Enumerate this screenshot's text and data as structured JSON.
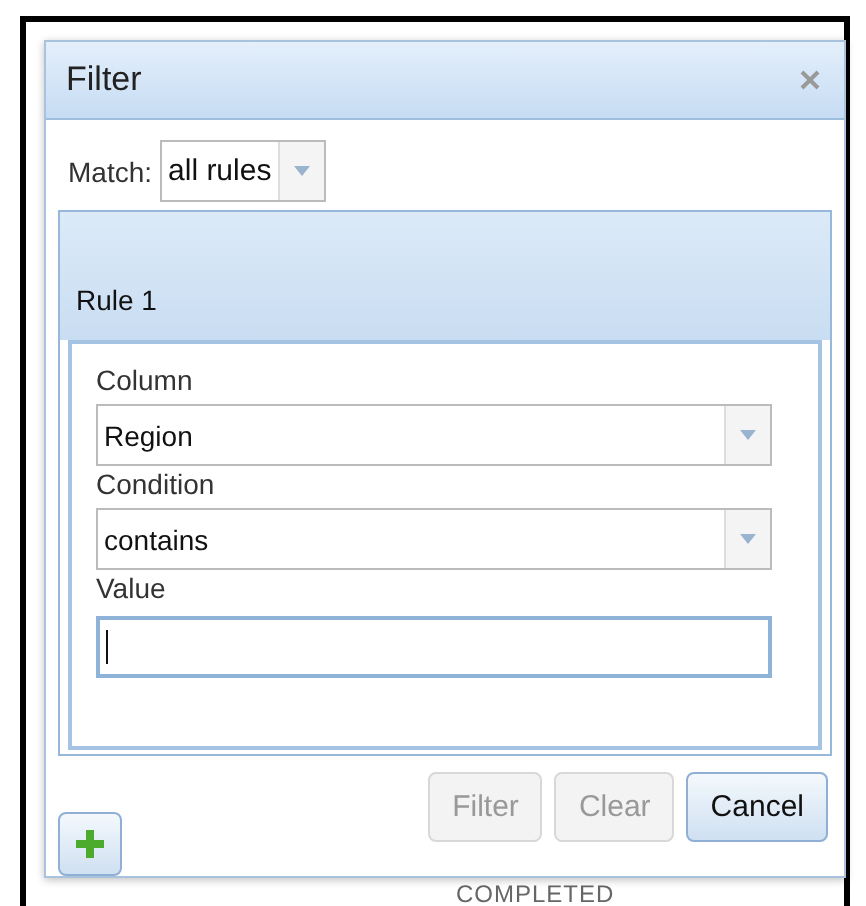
{
  "dialog": {
    "title": "Filter",
    "match": {
      "label": "Match:",
      "value": "all rules"
    },
    "rules": [
      {
        "title": "Rule 1",
        "fields": [
          {
            "kind": "select",
            "label": "Column",
            "value": "Region"
          },
          {
            "kind": "select",
            "label": "Condition",
            "value": "contains"
          },
          {
            "kind": "text",
            "label": "Value",
            "focused": true
          }
        ]
      }
    ],
    "buttons": [
      {
        "label": "Filter",
        "disabled": true
      },
      {
        "label": "Clear",
        "disabled": true
      },
      {
        "label": "Cancel",
        "disabled": false
      }
    ]
  },
  "background": {
    "status_text": "COMPLETED"
  }
}
